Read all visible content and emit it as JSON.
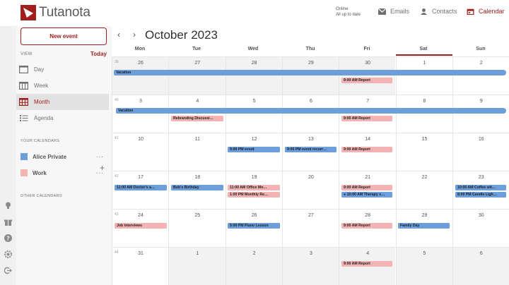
{
  "app": {
    "logo_text": "Tutanota",
    "status_line1": "Online",
    "status_line2": "All up to date",
    "nav": {
      "emails": "Emails",
      "contacts": "Contacts",
      "calendar": "Calendar"
    }
  },
  "sidebar": {
    "new_event": "New event",
    "view_label": "VIEW",
    "today": "Today",
    "views": [
      "Day",
      "Week",
      "Month",
      "Agenda"
    ],
    "your_calendars_label": "YOUR CALENDARS",
    "calendars": [
      {
        "name": "Alice Private",
        "color": "#6b9edb"
      },
      {
        "name": "Work",
        "color": "#f3b3b3"
      }
    ],
    "other_calendars_label": "OTHER CALENDARS"
  },
  "calendar": {
    "title": "October 2023",
    "weekdays": [
      "Mon",
      "Tue",
      "Wed",
      "Thu",
      "Fri",
      "Sat",
      "Sun"
    ],
    "weeks": [
      {
        "number": "39",
        "days": [
          "26",
          "27",
          "28",
          "29",
          "30",
          "1",
          "2"
        ]
      },
      {
        "number": "40",
        "days": [
          "3",
          "4",
          "5",
          "6",
          "7",
          "8",
          "9"
        ]
      },
      {
        "number": "41",
        "days": [
          "10",
          "11",
          "12",
          "13",
          "14",
          "15",
          "16"
        ]
      },
      {
        "number": "42",
        "days": [
          "17",
          "18",
          "19",
          "20",
          "21",
          "22",
          "23"
        ]
      },
      {
        "number": "43",
        "days": [
          "24",
          "25",
          "26",
          "27",
          "28",
          "29",
          "30"
        ]
      },
      {
        "number": "44",
        "days": [
          "31",
          "1",
          "2",
          "3",
          "4",
          "5",
          "6"
        ]
      }
    ],
    "events": {
      "vacation": "Vacation",
      "report": "9:00 AM Report",
      "rebranding": "Rebranding Discussi…",
      "w41_wed": "9:00 PM event",
      "w41_thu": "9:00 PM event recurr…",
      "w42_mon": "11:00 AM Doctor's a…",
      "w42_tue": "Bob's Birthday",
      "w42_wed_1": "11:00 AM Office Mo…",
      "w42_wed_2": "1:00 PM Monthly Re…",
      "w42_fri_2": "● 10:00 AM Therapy s…",
      "w42_sun_1": "10:00 AM Coffee wit…",
      "w42_sun_2": "8:00 PM Candle Ligh…",
      "w43_mon": "Job interviews",
      "w43_wed": "5:00 PM Piano Lesson",
      "w43_sat": "Family Day"
    }
  },
  "colors": {
    "accent": "#a01e1e",
    "private": "#6b9edb",
    "work": "#f3b3b3"
  }
}
